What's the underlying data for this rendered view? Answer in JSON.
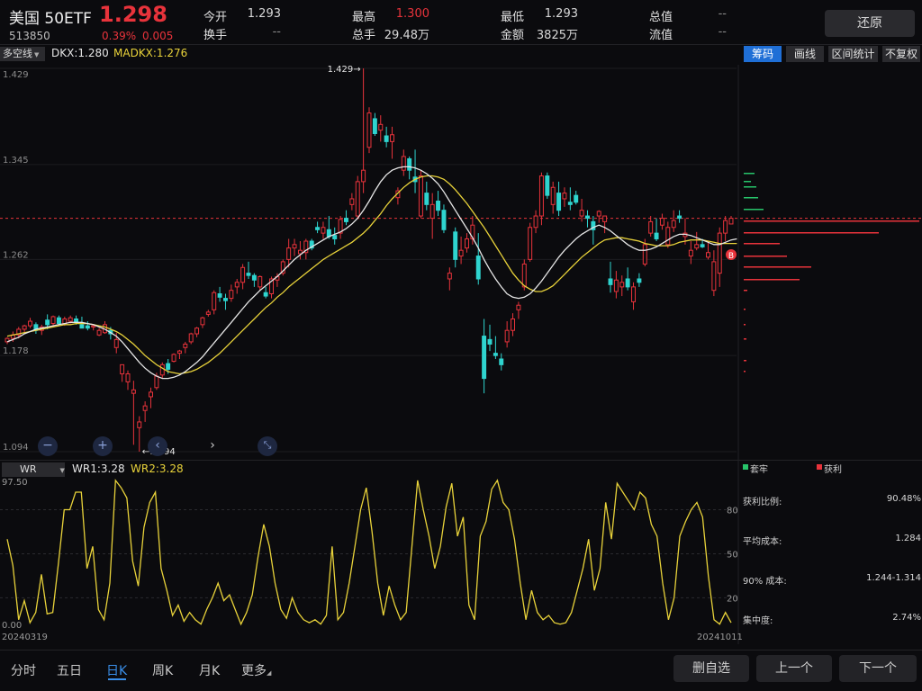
{
  "header": {
    "name": "美国 50ETF",
    "price": "1.298",
    "code": "513850",
    "change_pct": "0.39%",
    "change": "0.005",
    "quote": [
      {
        "label": "今开",
        "value": "1.293"
      },
      {
        "label": "换手",
        "value": "--"
      },
      {
        "label": "最高",
        "value": "1.300"
      },
      {
        "label": "总手",
        "value": "29.48万"
      },
      {
        "label": "最低",
        "value": "1.293"
      },
      {
        "label": "金额",
        "value": "3825万"
      },
      {
        "label": "总值",
        "value": "--"
      },
      {
        "label": "流值",
        "value": "--"
      }
    ],
    "restore_label": "还原"
  },
  "indicator": {
    "select": "多空线",
    "dkx": "DKX:1.280",
    "madkx": "MADKX:1.276"
  },
  "toolbar": [
    "筹码",
    "画线",
    "区间统计",
    "不复权"
  ],
  "wr_panel": {
    "select": "WR",
    "wr1": "WR1:3.28",
    "wr2": "WR2:3.28"
  },
  "side_panel": {
    "legend_trapped": "套牢",
    "legend_profit": "获利",
    "stats": [
      {
        "label": "获利比例:",
        "value": "90.48%"
      },
      {
        "label": "平均成本:",
        "value": "1.284"
      },
      {
        "label": "90% 成本:",
        "value": "1.244-1.314"
      },
      {
        "label": "集中度:",
        "value": "2.74%"
      }
    ],
    "b_marker": "B"
  },
  "colors": {
    "up": "#e8333b",
    "down": "#2fd4cf",
    "dkx": "#e6e6e6",
    "madkx": "#e8d23a",
    "wr": "#e8d23a",
    "accent": "#3a8ee8"
  },
  "icons": [
    "zoom-out-icon",
    "zoom-in-icon",
    "scroll-left-icon",
    "scroll-right-icon",
    "reset-zoom-icon"
  ],
  "bottom": {
    "tabs": [
      "分时",
      "五日",
      "日K",
      "周K",
      "月K",
      "更多"
    ],
    "buttons": [
      "删自选",
      "上一个",
      "下一个"
    ]
  },
  "chart_data": [
    {
      "type": "candlestick",
      "title": "",
      "x_start": "20240319",
      "x_end": "20241011",
      "ylim": [
        1.094,
        1.429
      ],
      "y_ticks": [
        "1.429",
        "1.345",
        "1.262",
        "1.178",
        "1.094"
      ],
      "high_label": "1.429",
      "low_label": "1.094",
      "current_price": 1.298,
      "ohlc": [
        [
          1.19,
          1.194,
          1.188,
          1.193
        ],
        [
          1.193,
          1.199,
          1.19,
          1.196
        ],
        [
          1.196,
          1.203,
          1.193,
          1.201
        ],
        [
          1.201,
          1.205,
          1.197,
          1.204
        ],
        [
          1.204,
          1.211,
          1.202,
          1.208
        ],
        [
          1.205,
          1.207,
          1.197,
          1.2
        ],
        [
          1.2,
          1.205,
          1.196,
          1.203
        ],
        [
          1.209,
          1.214,
          1.201,
          1.205
        ],
        [
          1.206,
          1.213,
          1.203,
          1.212
        ],
        [
          1.211,
          1.213,
          1.205,
          1.206
        ],
        [
          1.206,
          1.212,
          1.204,
          1.21
        ],
        [
          1.208,
          1.213,
          1.206,
          1.211
        ],
        [
          1.21,
          1.213,
          1.205,
          1.207
        ],
        [
          1.205,
          1.212,
          1.204,
          1.202
        ],
        [
          1.204,
          1.208,
          1.2,
          1.202
        ],
        [
          1.203,
          1.205,
          1.2,
          1.204
        ],
        [
          1.196,
          1.202,
          1.195,
          1.2
        ],
        [
          1.198,
          1.208,
          1.197,
          1.205
        ],
        [
          1.2,
          1.203,
          1.192,
          1.197
        ],
        [
          1.185,
          1.198,
          1.18,
          1.192
        ],
        [
          1.162,
          1.17,
          1.155,
          1.17
        ],
        [
          1.155,
          1.165,
          1.148,
          1.162
        ],
        [
          1.145,
          1.156,
          1.1,
          1.148
        ],
        [
          1.115,
          1.125,
          1.094,
          1.12
        ],
        [
          1.13,
          1.138,
          1.12,
          1.134
        ],
        [
          1.142,
          1.15,
          1.132,
          1.146
        ],
        [
          1.15,
          1.163,
          1.148,
          1.16
        ],
        [
          1.161,
          1.172,
          1.158,
          1.17
        ],
        [
          1.171,
          1.175,
          1.162,
          1.166
        ],
        [
          1.173,
          1.18,
          1.172,
          1.179
        ],
        [
          1.18,
          1.183,
          1.175,
          1.182
        ],
        [
          1.185,
          1.19,
          1.18,
          1.188
        ],
        [
          1.19,
          1.198,
          1.188,
          1.197
        ],
        [
          1.197,
          1.203,
          1.194,
          1.202
        ],
        [
          1.205,
          1.212,
          1.202,
          1.211
        ],
        [
          1.214,
          1.218,
          1.212,
          1.216
        ],
        [
          1.218,
          1.235,
          1.214,
          1.233
        ],
        [
          1.232,
          1.238,
          1.225,
          1.229
        ],
        [
          1.228,
          1.232,
          1.218,
          1.226
        ],
        [
          1.228,
          1.24,
          1.225,
          1.235
        ],
        [
          1.238,
          1.245,
          1.232,
          1.242
        ],
        [
          1.242,
          1.258,
          1.236,
          1.255
        ],
        [
          1.25,
          1.26,
          1.245,
          1.248
        ],
        [
          1.248,
          1.25,
          1.238,
          1.244
        ],
        [
          1.238,
          1.248,
          1.235,
          1.247
        ],
        [
          1.233,
          1.238,
          1.228,
          1.23
        ],
        [
          1.232,
          1.247,
          1.228,
          1.245
        ],
        [
          1.244,
          1.25,
          1.238,
          1.247
        ],
        [
          1.25,
          1.262,
          1.248,
          1.26
        ],
        [
          1.262,
          1.28,
          1.255,
          1.272
        ],
        [
          1.272,
          1.28,
          1.265,
          1.275
        ],
        [
          1.267,
          1.278,
          1.262,
          1.27
        ],
        [
          1.268,
          1.28,
          1.262,
          1.278
        ],
        [
          1.278,
          1.28,
          1.27,
          1.272
        ],
        [
          1.29,
          1.295,
          1.285,
          1.288
        ],
        [
          1.285,
          1.295,
          1.28,
          1.29
        ],
        [
          1.288,
          1.3,
          1.28,
          1.282
        ],
        [
          1.283,
          1.29,
          1.275,
          1.28
        ],
        [
          1.285,
          1.3,
          1.28,
          1.297
        ],
        [
          1.298,
          1.305,
          1.292,
          1.295
        ],
        [
          1.31,
          1.32,
          1.305,
          1.315
        ],
        [
          1.3,
          1.335,
          1.298,
          1.33
        ],
        [
          1.33,
          1.429,
          1.32,
          1.34
        ],
        [
          1.36,
          1.395,
          1.355,
          1.39
        ],
        [
          1.385,
          1.39,
          1.37,
          1.372
        ],
        [
          1.375,
          1.388,
          1.365,
          1.38
        ],
        [
          1.37,
          1.378,
          1.36,
          1.365
        ],
        [
          1.365,
          1.378,
          1.35,
          1.371
        ],
        [
          1.316,
          1.325,
          1.31,
          1.322
        ],
        [
          1.34,
          1.358,
          1.335,
          1.352
        ],
        [
          1.35,
          1.352,
          1.332,
          1.34
        ],
        [
          1.334,
          1.358,
          1.32,
          1.33
        ],
        [
          1.3,
          1.34,
          1.298,
          1.335
        ],
        [
          1.32,
          1.33,
          1.305,
          1.31
        ],
        [
          1.298,
          1.32,
          1.28,
          1.31
        ],
        [
          1.313,
          1.322,
          1.3,
          1.305
        ],
        [
          1.305,
          1.31,
          1.285,
          1.288
        ],
        [
          1.245,
          1.255,
          1.235,
          1.25
        ],
        [
          1.286,
          1.29,
          1.255,
          1.262
        ],
        [
          1.265,
          1.282,
          1.258,
          1.27
        ],
        [
          1.272,
          1.285,
          1.268,
          1.28
        ],
        [
          1.28,
          1.3,
          1.275,
          1.292
        ],
        [
          1.265,
          1.285,
          1.24,
          1.245
        ],
        [
          1.195,
          1.21,
          1.145,
          1.158
        ],
        [
          1.192,
          1.205,
          1.182,
          1.188
        ],
        [
          1.18,
          1.195,
          1.175,
          1.178
        ],
        [
          1.175,
          1.18,
          1.165,
          1.17
        ],
        [
          1.19,
          1.208,
          1.185,
          1.2
        ],
        [
          1.2,
          1.215,
          1.195,
          1.21
        ],
        [
          1.218,
          1.225,
          1.21,
          1.222
        ],
        [
          1.238,
          1.262,
          1.235,
          1.258
        ],
        [
          1.262,
          1.294,
          1.26,
          1.29
        ],
        [
          1.29,
          1.305,
          1.285,
          1.3
        ],
        [
          1.3,
          1.338,
          1.292,
          1.335
        ],
        [
          1.335,
          1.338,
          1.315,
          1.318
        ],
        [
          1.31,
          1.33,
          1.302,
          1.325
        ],
        [
          1.32,
          1.33,
          1.3,
          1.305
        ],
        [
          1.315,
          1.325,
          1.308,
          1.32
        ],
        [
          1.312,
          1.325,
          1.305,
          1.31
        ],
        [
          1.318,
          1.322,
          1.31,
          1.312
        ],
        [
          1.3,
          1.315,
          1.295,
          1.305
        ],
        [
          1.3,
          1.305,
          1.29,
          1.298
        ],
        [
          1.295,
          1.3,
          1.275,
          1.288
        ],
        [
          1.3,
          1.305,
          1.294,
          1.304
        ],
        [
          1.295,
          1.3,
          1.285,
          1.3
        ],
        [
          1.245,
          1.26,
          1.233,
          1.24
        ],
        [
          1.234,
          1.252,
          1.228,
          1.244
        ],
        [
          1.238,
          1.248,
          1.23,
          1.242
        ],
        [
          1.245,
          1.255,
          1.235,
          1.238
        ],
        [
          1.225,
          1.242,
          1.218,
          1.238
        ],
        [
          1.245,
          1.25,
          1.238,
          1.242
        ],
        [
          1.258,
          1.28,
          1.256,
          1.275
        ],
        [
          1.285,
          1.3,
          1.282,
          1.295
        ],
        [
          1.285,
          1.298,
          1.278,
          1.28
        ],
        [
          1.292,
          1.302,
          1.288,
          1.298
        ],
        [
          1.275,
          1.295,
          1.272,
          1.29
        ],
        [
          1.29,
          1.305,
          1.286,
          1.296
        ],
        [
          1.3,
          1.305,
          1.294,
          1.298
        ],
        [
          1.282,
          1.298,
          1.275,
          1.285
        ],
        [
          1.265,
          1.278,
          1.258,
          1.27
        ],
        [
          1.272,
          1.286,
          1.27,
          1.275
        ],
        [
          1.275,
          1.28,
          1.272,
          1.273
        ],
        [
          1.264,
          1.278,
          1.262,
          1.268
        ],
        [
          1.235,
          1.27,
          1.23,
          1.26
        ],
        [
          1.25,
          1.29,
          1.238,
          1.285
        ],
        [
          1.285,
          1.3,
          1.278,
          1.296
        ],
        [
          1.293,
          1.3,
          1.293,
          1.298
        ]
      ],
      "dkx": [
        1.19,
        1.192,
        1.194,
        1.197,
        1.199,
        1.201,
        1.202,
        1.203,
        1.204,
        1.205,
        1.206,
        1.207,
        1.207,
        1.207,
        1.206,
        1.205,
        1.203,
        1.201,
        1.198,
        1.195,
        1.19,
        1.184,
        1.178,
        1.172,
        1.167,
        1.163,
        1.16,
        1.158,
        1.158,
        1.159,
        1.161,
        1.164,
        1.168,
        1.172,
        1.177,
        1.183,
        1.189,
        1.195,
        1.201,
        1.207,
        1.213,
        1.219,
        1.225,
        1.23,
        1.235,
        1.239,
        1.243,
        1.247,
        1.252,
        1.257,
        1.262,
        1.266,
        1.27,
        1.273,
        1.276,
        1.279,
        1.282,
        1.284,
        1.286,
        1.289,
        1.293,
        1.298,
        1.305,
        1.313,
        1.322,
        1.33,
        1.336,
        1.34,
        1.342,
        1.343,
        1.343,
        1.342,
        1.34,
        1.337,
        1.333,
        1.328,
        1.321,
        1.313,
        1.305,
        1.297,
        1.289,
        1.281,
        1.272,
        1.262,
        1.253,
        1.245,
        1.238,
        1.232,
        1.229,
        1.228,
        1.229,
        1.232,
        1.237,
        1.243,
        1.25,
        1.257,
        1.264,
        1.27,
        1.275,
        1.28,
        1.284,
        1.287,
        1.29,
        1.292,
        1.29,
        1.287,
        1.283,
        1.279,
        1.275,
        1.272,
        1.27,
        1.27,
        1.271,
        1.273,
        1.276,
        1.279,
        1.282,
        1.284,
        1.284,
        1.283,
        1.281,
        1.279,
        1.277,
        1.275,
        1.275,
        1.277,
        1.279,
        1.28
      ],
      "madkx": [
        1.195,
        1.196,
        1.197,
        1.198,
        1.199,
        1.2,
        1.201,
        1.202,
        1.203,
        1.204,
        1.205,
        1.205,
        1.206,
        1.206,
        1.206,
        1.205,
        1.204,
        1.203,
        1.201,
        1.199,
        1.196,
        1.192,
        1.188,
        1.183,
        1.178,
        1.174,
        1.17,
        1.167,
        1.164,
        1.163,
        1.162,
        1.163,
        1.164,
        1.166,
        1.169,
        1.172,
        1.176,
        1.18,
        1.185,
        1.19,
        1.195,
        1.2,
        1.205,
        1.21,
        1.215,
        1.22,
        1.224,
        1.229,
        1.233,
        1.238,
        1.242,
        1.246,
        1.25,
        1.254,
        1.258,
        1.262,
        1.265,
        1.268,
        1.271,
        1.274,
        1.277,
        1.281,
        1.285,
        1.29,
        1.296,
        1.302,
        1.309,
        1.315,
        1.32,
        1.325,
        1.329,
        1.332,
        1.334,
        1.335,
        1.335,
        1.334,
        1.332,
        1.328,
        1.323,
        1.317,
        1.311,
        1.304,
        1.297,
        1.29,
        1.282,
        1.274,
        1.266,
        1.258,
        1.25,
        1.244,
        1.239,
        1.236,
        1.234,
        1.234,
        1.236,
        1.239,
        1.244,
        1.249,
        1.254,
        1.259,
        1.264,
        1.268,
        1.272,
        1.276,
        1.279,
        1.28,
        1.281,
        1.281,
        1.28,
        1.279,
        1.278,
        1.276,
        1.275,
        1.274,
        1.274,
        1.274,
        1.275,
        1.277,
        1.278,
        1.279,
        1.279,
        1.279,
        1.278,
        1.277,
        1.276,
        1.276,
        1.276,
        1.276
      ]
    },
    {
      "type": "line",
      "title": "",
      "ylim": [
        0,
        97.5
      ],
      "y_ticks": [
        "97.50",
        "0.00"
      ],
      "levels": [
        80,
        50,
        20
      ],
      "series": [
        {
          "name": "WR2",
          "values": [
            60,
            42,
            5,
            18,
            3,
            10,
            36,
            9,
            10,
            44,
            80,
            80,
            92,
            92,
            40,
            55,
            12,
            5,
            30,
            100,
            95,
            88,
            45,
            28,
            68,
            85,
            92,
            40,
            25,
            8,
            15,
            4,
            10,
            5,
            2,
            12,
            20,
            30,
            18,
            22,
            12,
            2,
            10,
            22,
            48,
            70,
            55,
            30,
            12,
            6,
            20,
            10,
            5,
            3,
            5,
            2,
            8,
            55,
            5,
            10,
            30,
            55,
            80,
            95,
            65,
            30,
            8,
            28,
            15,
            5,
            10,
            55,
            100,
            80,
            62,
            40,
            55,
            82,
            98,
            62,
            75,
            15,
            5,
            62,
            72,
            94,
            100,
            85,
            80,
            60,
            30,
            5,
            25,
            10,
            5,
            8,
            3,
            2,
            3,
            10,
            25,
            40,
            60,
            25,
            40,
            85,
            60,
            98,
            92,
            86,
            80,
            92,
            88,
            70,
            62,
            30,
            5,
            20,
            62,
            72,
            80,
            85,
            75,
            35,
            5,
            2,
            10,
            3
          ]
        }
      ]
    }
  ]
}
